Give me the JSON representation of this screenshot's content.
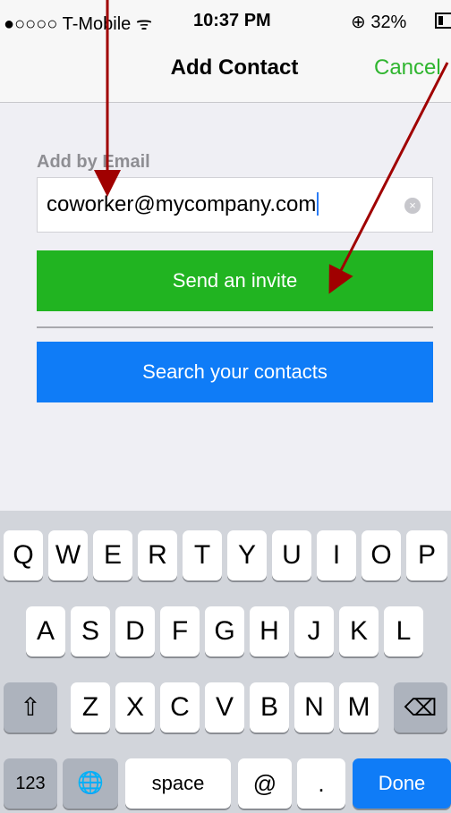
{
  "status_bar": {
    "carrier": "●○○○○ T-Mobile ᯤ",
    "time": "10:37 PM",
    "battery": "⊕ 32%"
  },
  "nav": {
    "title": "Add Contact",
    "cancel_label": "Cancel"
  },
  "form": {
    "section_label": "Add by Email",
    "email_value": "coworker@mycompany.com",
    "clear_icon": "×",
    "send_invite_label": "Send an invite",
    "search_contacts_label": "Search your contacts"
  },
  "keyboard": {
    "row1": [
      "Q",
      "W",
      "E",
      "R",
      "T",
      "Y",
      "U",
      "I",
      "O",
      "P"
    ],
    "row2": [
      "A",
      "S",
      "D",
      "F",
      "G",
      "H",
      "J",
      "K",
      "L"
    ],
    "row3": [
      "Z",
      "X",
      "C",
      "V",
      "B",
      "N",
      "M"
    ],
    "shift_icon": "⇧",
    "delete_icon": "⌫",
    "numbers_label": "123",
    "globe_icon": "🌐",
    "space_label": "space",
    "at_label": "@",
    "dot_label": ".",
    "done_label": "Done"
  },
  "colors": {
    "send_green": "#21b421",
    "search_blue": "#0f7cf7",
    "cancel_green": "#2fb52f",
    "annotation_arrow": "#a00000"
  }
}
